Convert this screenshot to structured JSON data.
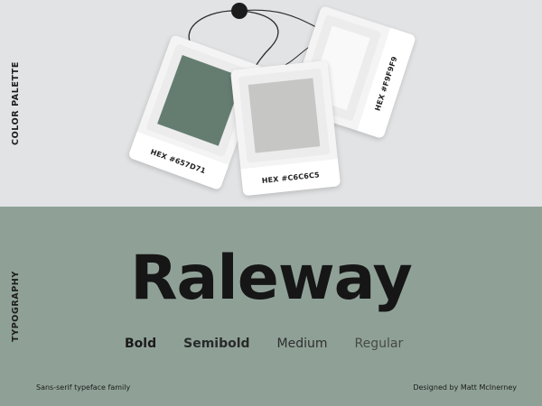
{
  "sections": {
    "color_palette_label": "COLOR PALETTE",
    "typography_label": "TYPOGRAPHY"
  },
  "swatches": [
    {
      "hex_label": "HEX #657D71",
      "color": "#657d71"
    },
    {
      "hex_label": "HEX #C6C6C5",
      "color": "#c6c6c5"
    },
    {
      "hex_label": "HEX #F9F9F9",
      "color": "#f9f9f9"
    }
  ],
  "typography": {
    "font_name": "Raleway",
    "weights": [
      "Bold",
      "Semibold",
      "Medium",
      "Regular"
    ],
    "description": "Sans-serif typeface family",
    "credit": "Designed by Matt McInerney"
  },
  "colors": {
    "top_background": "#e2e3e4",
    "bottom_background": "#8fa197"
  }
}
